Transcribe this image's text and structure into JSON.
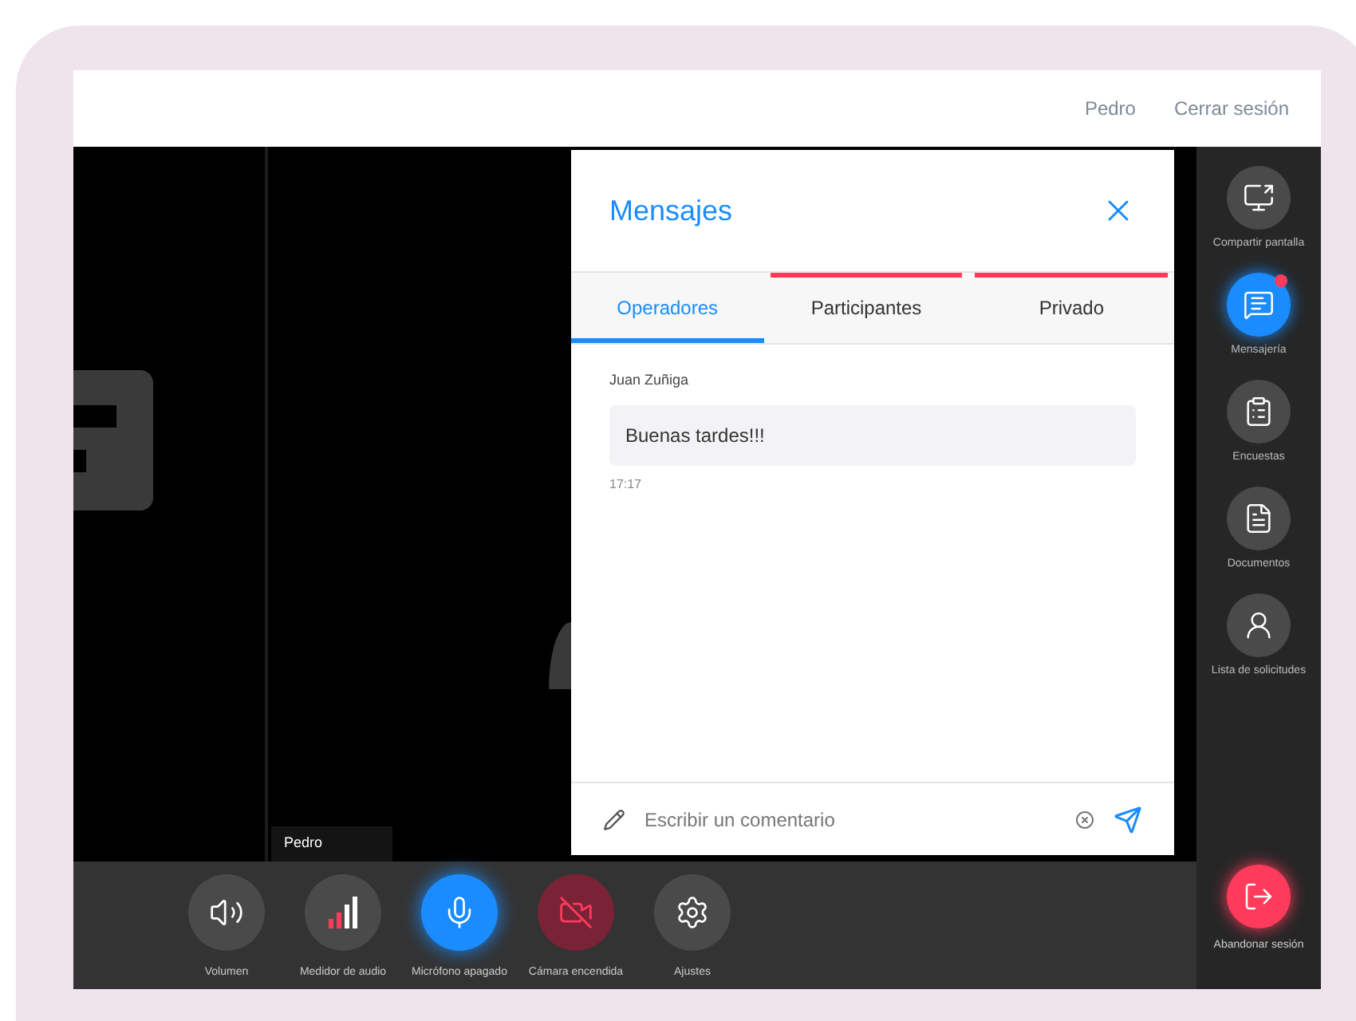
{
  "header": {
    "user": "Pedro",
    "logout": "Cerrar sesión"
  },
  "video": {
    "participant_label": "Pedro"
  },
  "messages_panel": {
    "title": "Mensajes",
    "tabs": [
      {
        "label": "Operadores",
        "selected": true,
        "alert": false
      },
      {
        "label": "Participantes",
        "selected": false,
        "alert": true
      },
      {
        "label": "Privado",
        "selected": false,
        "alert": true
      }
    ],
    "messages": [
      {
        "sender": "Juan Zuñiga",
        "text": "Buenas tardes!!!",
        "time": "17:17"
      }
    ],
    "composer": {
      "placeholder": "Escribir un comentario"
    }
  },
  "toolbar": [
    {
      "kind": "volume",
      "label": "Volumen",
      "active": false,
      "warning": false
    },
    {
      "kind": "meter",
      "label": "Medidor de audio",
      "active": false,
      "warning": false
    },
    {
      "kind": "mic",
      "label": "Micrófono apagado",
      "active": true,
      "warning": false
    },
    {
      "kind": "camera",
      "label": "Cámara encendida",
      "active": false,
      "warning": true
    },
    {
      "kind": "settings",
      "label": "Ajustes",
      "active": false,
      "warning": false
    }
  ],
  "sidebar": [
    {
      "kind": "share",
      "label": "Compartir pantalla",
      "selected": false,
      "badge": false
    },
    {
      "kind": "chat",
      "label": "Mensajería",
      "selected": true,
      "badge": true
    },
    {
      "kind": "polls",
      "label": "Encuestas",
      "selected": false,
      "badge": false
    },
    {
      "kind": "documents",
      "label": "Documentos",
      "selected": false,
      "badge": false
    },
    {
      "kind": "requests",
      "label": "Lista de solicitudes",
      "selected": false,
      "badge": false
    }
  ],
  "leave": {
    "label": "Abandonar sesión"
  }
}
